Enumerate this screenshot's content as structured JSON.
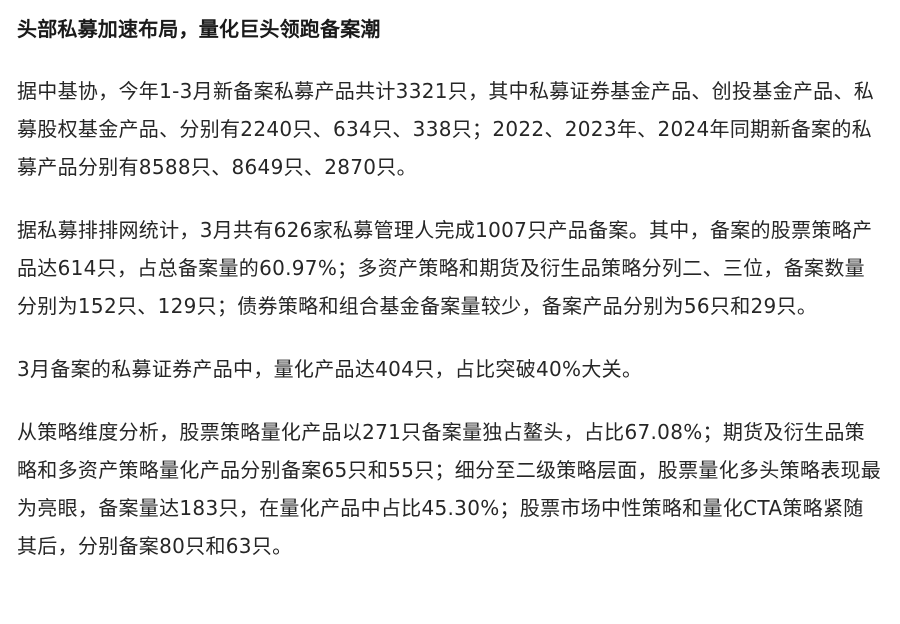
{
  "article": {
    "headline": "头部私募加速布局，量化巨头领跑备案潮",
    "paragraphs": [
      "据中基协，今年1-3月新备案私募产品共计3321只，其中私募证券基金产品、创投基金产品、私募股权基金产品、分别有2240只、634只、338只；2022、2023年、2024年同期新备案的私募产品分别有8588只、8649只、2870只。",
      "据私募排排网统计，3月共有626家私募管理人完成1007只产品备案。其中，备案的股票策略产品达614只，占总备案量的60.97%；多资产策略和期货及衍生品策略分列二、三位，备案数量分别为152只、129只；债券策略和组合基金备案量较少，备案产品分别为56只和29只。",
      "3月备案的私募证券产品中，量化产品达404只，占比突破40%大关。",
      "从策略维度分析，股票策略量化产品以271只备案量独占鳌头，占比67.08%；期货及衍生品策略和多资产策略量化产品分别备案65只和55只；细分至二级策略层面，股票量化多头策略表现最为亮眼，备案量达183只，在量化产品中占比45.30%；股票市场中性策略和量化CTA策略紧随其后，分别备案80只和63只。"
    ]
  }
}
